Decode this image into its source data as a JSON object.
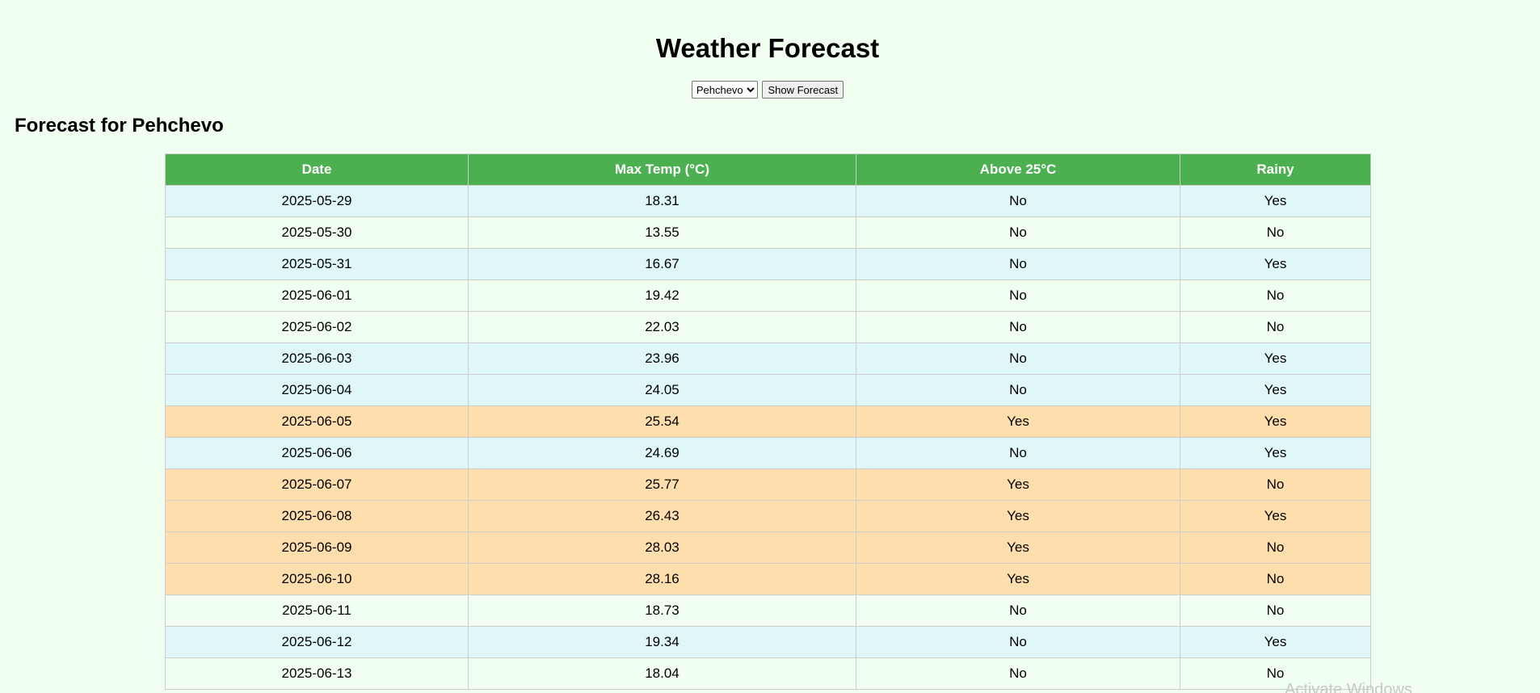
{
  "page": {
    "title": "Weather Forecast",
    "forecast_heading": "Forecast for Pehchevo"
  },
  "controls": {
    "city_selected": "Pehchevo",
    "button_label": "Show Forecast"
  },
  "table": {
    "headers": [
      "Date",
      "Max Temp (°C)",
      "Above 25°C",
      "Rainy"
    ],
    "rows": [
      {
        "date": "2025-05-29",
        "max_temp": "18.31",
        "above_25": "No",
        "rainy": "Yes",
        "style": "cool"
      },
      {
        "date": "2025-05-30",
        "max_temp": "13.55",
        "above_25": "No",
        "rainy": "No",
        "style": "normal"
      },
      {
        "date": "2025-05-31",
        "max_temp": "16.67",
        "above_25": "No",
        "rainy": "Yes",
        "style": "cool"
      },
      {
        "date": "2025-06-01",
        "max_temp": "19.42",
        "above_25": "No",
        "rainy": "No",
        "style": "normal"
      },
      {
        "date": "2025-06-02",
        "max_temp": "22.03",
        "above_25": "No",
        "rainy": "No",
        "style": "normal"
      },
      {
        "date": "2025-06-03",
        "max_temp": "23.96",
        "above_25": "No",
        "rainy": "Yes",
        "style": "cool"
      },
      {
        "date": "2025-06-04",
        "max_temp": "24.05",
        "above_25": "No",
        "rainy": "Yes",
        "style": "cool"
      },
      {
        "date": "2025-06-05",
        "max_temp": "25.54",
        "above_25": "Yes",
        "rainy": "Yes",
        "style": "hot"
      },
      {
        "date": "2025-06-06",
        "max_temp": "24.69",
        "above_25": "No",
        "rainy": "Yes",
        "style": "cool"
      },
      {
        "date": "2025-06-07",
        "max_temp": "25.77",
        "above_25": "Yes",
        "rainy": "No",
        "style": "hot"
      },
      {
        "date": "2025-06-08",
        "max_temp": "26.43",
        "above_25": "Yes",
        "rainy": "Yes",
        "style": "hot"
      },
      {
        "date": "2025-06-09",
        "max_temp": "28.03",
        "above_25": "Yes",
        "rainy": "No",
        "style": "hot"
      },
      {
        "date": "2025-06-10",
        "max_temp": "28.16",
        "above_25": "Yes",
        "rainy": "No",
        "style": "hot"
      },
      {
        "date": "2025-06-11",
        "max_temp": "18.73",
        "above_25": "No",
        "rainy": "No",
        "style": "normal"
      },
      {
        "date": "2025-06-12",
        "max_temp": "19.34",
        "above_25": "No",
        "rainy": "Yes",
        "style": "cool"
      },
      {
        "date": "2025-06-13",
        "max_temp": "18.04",
        "above_25": "No",
        "rainy": "No",
        "style": "normal"
      }
    ]
  },
  "watermark": "Activate Windows",
  "colors": {
    "page_background": "#f0fff0",
    "header_green": "#4caf50",
    "row_cool": "#e0f7fa",
    "row_normal": "#f0fff0",
    "row_hot": "#ffdead"
  }
}
